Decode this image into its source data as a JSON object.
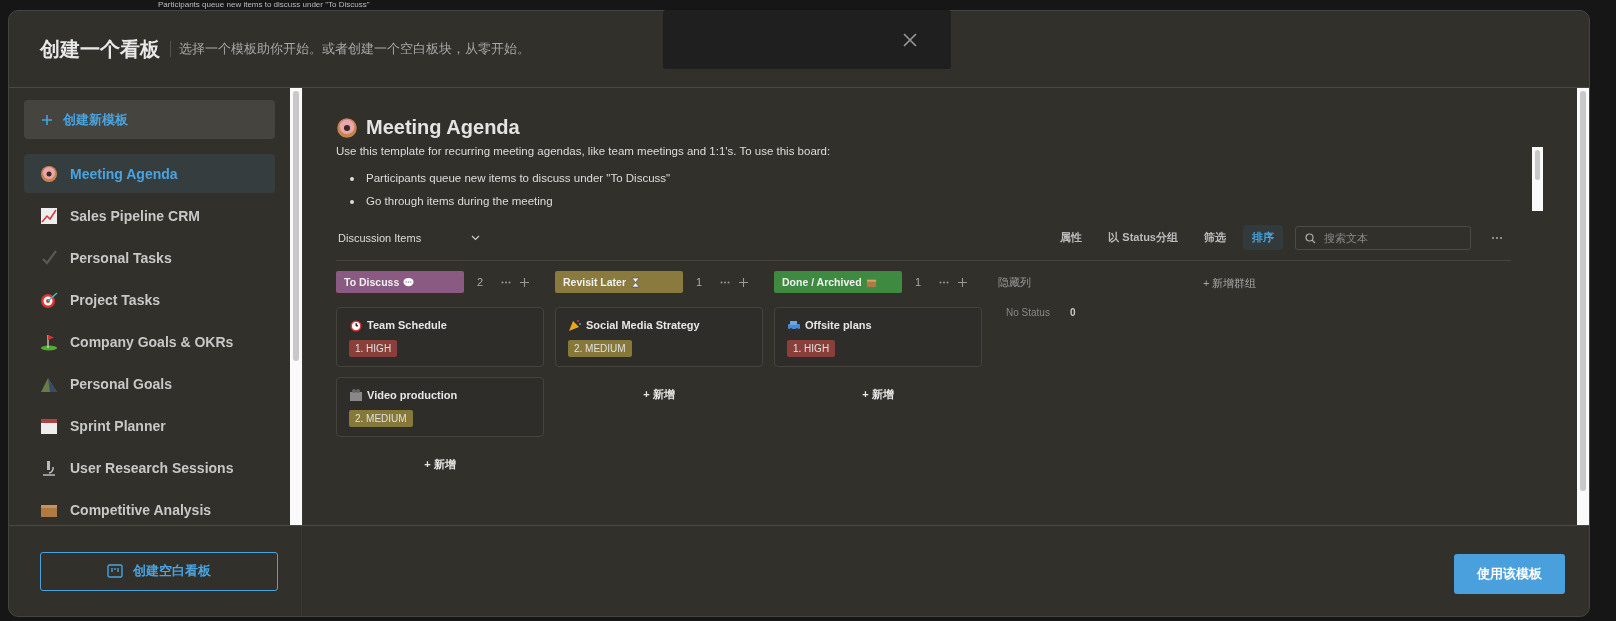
{
  "background_text": "Participants queue new items to discuss under \"To Discuss\"",
  "dialog": {
    "title": "创建一个看板",
    "subtitle": "选择一个模板助你开始。或者创建一个空白板块，从零开始。"
  },
  "sidebar": {
    "create_button": "创建新模板",
    "items": [
      {
        "label": "Meeting Agenda",
        "selected": true
      },
      {
        "label": "Sales Pipeline CRM",
        "selected": false
      },
      {
        "label": "Personal Tasks",
        "selected": false
      },
      {
        "label": "Project Tasks",
        "selected": false
      },
      {
        "label": "Company Goals & OKRs",
        "selected": false
      },
      {
        "label": "Personal Goals",
        "selected": false
      },
      {
        "label": "Sprint Planner",
        "selected": false
      },
      {
        "label": "User Research Sessions",
        "selected": false
      },
      {
        "label": "Competitive Analysis",
        "selected": false
      }
    ],
    "blank_button": "创建空白看板"
  },
  "template": {
    "title": "Meeting Agenda",
    "description": "Use this template for recurring meeting agendas, like team meetings and 1:1's. To use this board:",
    "bullets": [
      "Participants queue new items to discuss under \"To Discuss\"",
      "Go through items during the meeting"
    ],
    "view": "Discussion Items",
    "toolbar": [
      {
        "label": "属性",
        "selected": false
      },
      {
        "label": "以 Status分组",
        "selected": false
      },
      {
        "label": "筛选",
        "selected": false
      },
      {
        "label": "排序",
        "selected": true
      }
    ],
    "search": {
      "placeholder": "搜索文本"
    },
    "columns": [
      {
        "title": "To Discuss",
        "color": "#8a5a83",
        "count": "2",
        "add": "+ 新增",
        "cards": [
          {
            "title": "Team Schedule",
            "priority": {
              "label": "1. HIGH",
              "color": "#8a3f3b"
            }
          },
          {
            "title": "Video production",
            "priority": {
              "label": "2. MEDIUM",
              "color": "#857839"
            }
          }
        ]
      },
      {
        "title": "Revisit Later",
        "color": "#8a7a3e",
        "count": "1",
        "add": "+ 新增",
        "cards": [
          {
            "title": "Social Media Strategy",
            "priority": {
              "label": "2. MEDIUM",
              "color": "#857839"
            }
          }
        ]
      },
      {
        "title": "Done / Archived",
        "color": "#3f8a41",
        "count": "1",
        "add": "+ 新增",
        "cards": [
          {
            "title": "Offsite plans",
            "priority": {
              "label": "1. HIGH",
              "color": "#8a3f3b"
            }
          }
        ]
      }
    ],
    "hidden": {
      "label": "隐藏列",
      "items": [
        {
          "label": "No Status",
          "count": "0"
        }
      ]
    },
    "add_group": "+ 新增群组"
  },
  "footer": {
    "use_button": "使用该模板"
  }
}
